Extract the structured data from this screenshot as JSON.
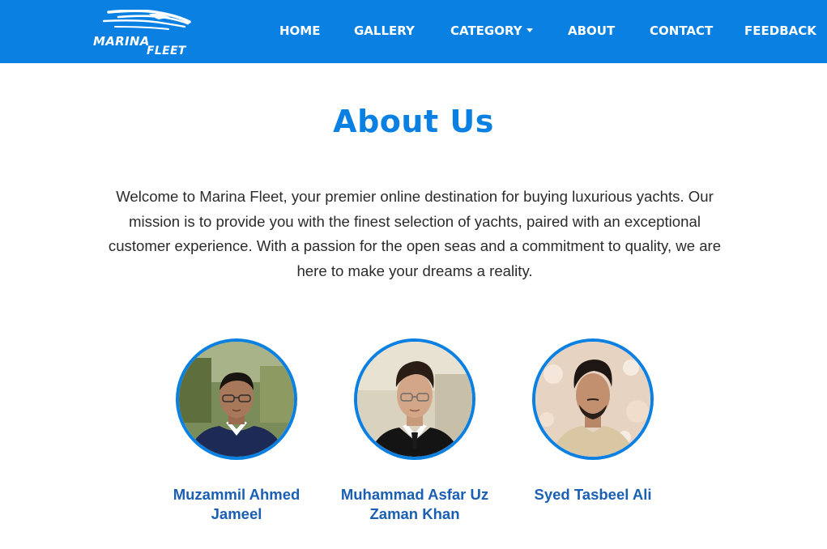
{
  "brand": {
    "line1": "MARINA",
    "line2": "FLEET",
    "icon": "yacht-logo-icon"
  },
  "nav": {
    "home": "HOME",
    "gallery": "GALLERY",
    "category": "CATEGORY",
    "about": "ABOUT",
    "contact": "CONTACT",
    "feedback": "FEEDBACK"
  },
  "about": {
    "title": "About Us",
    "intro_lines": [
      "Welcome to Marina Fleet, your premier online destination for buying luxurious yachts. Our",
      "mission is to provide you with the finest selection of yachts, paired with an exceptional",
      "customer experience. With a passion for the open seas and a commitment to quality, we are",
      "here to make your dreams a reality."
    ]
  },
  "team": [
    {
      "name_lines": [
        "Muzammil Ahmed",
        "Jameel"
      ]
    },
    {
      "name_lines": [
        "Muhammad Asfar Uz",
        "Zaman Khan"
      ]
    },
    {
      "name_lines": [
        "Syed Tasbeel Ali"
      ]
    }
  ],
  "colors": {
    "primary": "#0a80e3",
    "name_text": "#1a5fb4",
    "body_text": "#2b2b2b"
  }
}
